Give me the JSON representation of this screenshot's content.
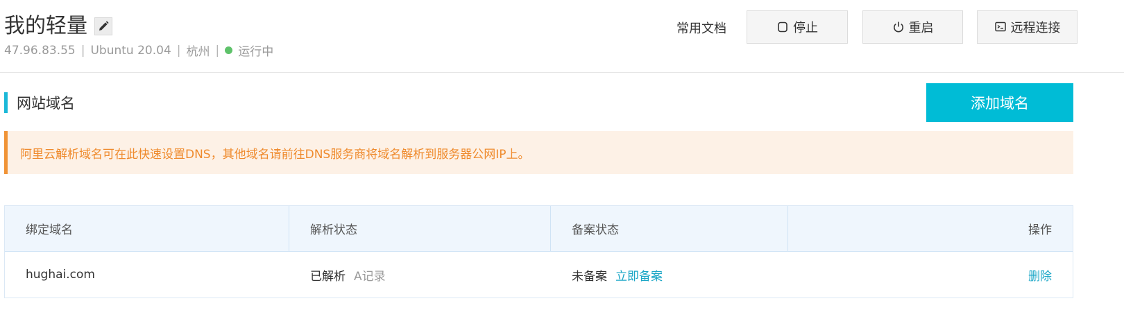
{
  "header": {
    "title": "我的轻量",
    "ip": "47.96.83.55",
    "os": "Ubuntu 20.04",
    "region": "杭州",
    "separator": "|",
    "status": "运行中",
    "status_color": "#5ec26a",
    "docs_label": "常用文档",
    "stop_label": "停止",
    "restart_label": "重启",
    "remote_label": "远程连接"
  },
  "section": {
    "title": "网站域名",
    "add_button": "添加域名",
    "accent_color": "#00bcd6",
    "notice": "阿里云解析域名可在此快速设置DNS，其他域名请前往DNS服务商将域名解析到服务器公网IP上。"
  },
  "table": {
    "columns": [
      "绑定域名",
      "解析状态",
      "备案状态",
      "操作"
    ],
    "rows": [
      {
        "domain": "hughai.com",
        "resolve_status": "已解析",
        "record_type": "A记录",
        "icp_status": "未备案",
        "icp_action": "立即备案",
        "action": "删除"
      }
    ]
  }
}
